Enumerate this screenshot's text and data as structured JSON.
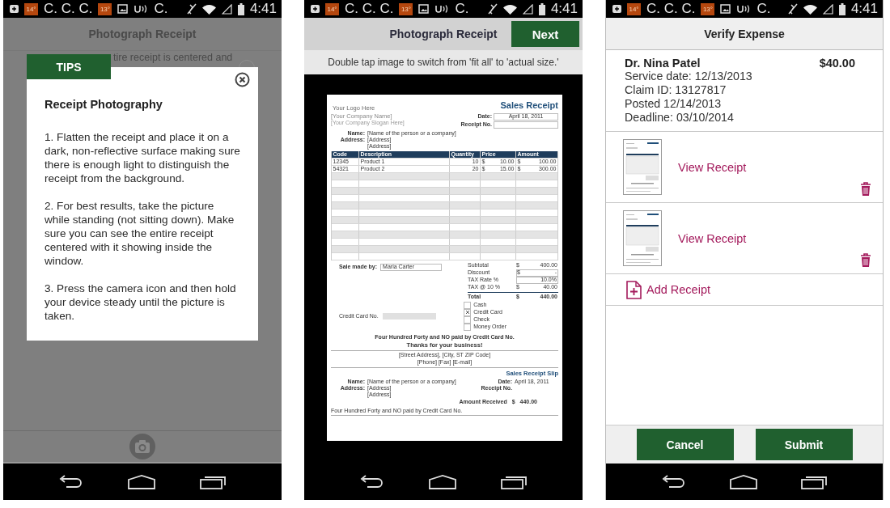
{
  "screens": [
    {
      "kind": "tips",
      "status_bar": {
        "temp_1": "14°",
        "text_1": "C. C. C.",
        "temp_2": "13°",
        "text_2": "C.",
        "time": "4:41"
      },
      "title": "Photograph Receipt",
      "background_text": "tire receipt is centered and",
      "dialog": {
        "tab": "TIPS",
        "heading": "Receipt Photography",
        "paragraphs": [
          "1. Flatten the receipt and place it on a dark, non-reflective surface making sure there is enough light to distinguish the receipt from the background.",
          "2. For best results, take the picture while standing (not sitting down).  Make sure you can see the entire receipt centered with it showing inside the window.",
          "3.  Press the camera icon and then hold your device steady until the picture is taken."
        ]
      }
    },
    {
      "kind": "photograph",
      "status_bar": {
        "temp_1": "14°",
        "text_1": "C. C. C.",
        "temp_2": "13°",
        "text_2": "C.",
        "time": "4:41"
      },
      "title": "Photograph Receipt",
      "next_button": "Next",
      "hint": "Double tap image to switch from 'fit all' to 'actual size.'",
      "receipt": {
        "logo": "Your Logo Here",
        "title": "Sales Receipt",
        "company": "[Your Company Name]",
        "slogan": "[Your Company Slogan Here]",
        "date_label": "Date:",
        "date": "April 18, 2011",
        "receipt_no_label": "Receipt No.",
        "name_label": "Name:",
        "name": "[Name of the person or a company]",
        "address_label": "Address:",
        "address_lines": [
          "[Address]",
          "[Address]"
        ],
        "columns": [
          "Code",
          "Description",
          "Quantity",
          "Price",
          "Amount"
        ],
        "rows": [
          {
            "code": "12345",
            "description": "Product 1",
            "quantity": "10",
            "price_symbol": "$",
            "price": "10.00",
            "amount_symbol": "$",
            "amount": "100.00"
          },
          {
            "code": "54321",
            "description": "Product 2",
            "quantity": "20",
            "price_symbol": "$",
            "price": "15.00",
            "amount_symbol": "$",
            "amount": "300.00"
          }
        ],
        "sale_by_label": "Sale made by:",
        "sale_by": "Maria Carter",
        "totals": [
          {
            "kind": "line",
            "label": "Subtotal",
            "symbol": "$",
            "value": "400.00"
          },
          {
            "kind": "boxed",
            "label": "Discount",
            "symbol": "$",
            "value": "-"
          },
          {
            "kind": "boxed",
            "label": "TAX Rate %",
            "value": "10.0%"
          },
          {
            "kind": "line",
            "label": "TAX @ 10 %",
            "symbol": "$",
            "value": "40.00"
          },
          {
            "kind": "total",
            "label": "Total",
            "symbol": "$",
            "value": "440.00"
          }
        ],
        "card_no_label": "Credit Card No.",
        "payment_methods": [
          {
            "label": "Cash",
            "checked": false
          },
          {
            "label": "Credit Card",
            "checked": true
          },
          {
            "label": "Check",
            "checked": false
          },
          {
            "label": "Money Order",
            "checked": false
          }
        ],
        "amount_words": "Four Hundred Forty and NO paid by Credit Card No.",
        "thanks": "Thanks for your business!",
        "address_footer": "[Street Address], [City, ST  ZIP Code]",
        "contact_footer": "[Phone]  [Fax]  [E-mail]",
        "slip": {
          "title": "Sales Receipt Slip",
          "name_label": "Name:",
          "name": "[Name of the person or a company]",
          "date_label": "Date:",
          "date": "April 18, 2011",
          "address_label": "Address:",
          "address_lines": [
            "[Address]",
            "[Address]"
          ],
          "receipt_no_label": "Receipt No.",
          "amount_label": "Amount Received",
          "amount_symbol": "$",
          "amount": "440.00",
          "amount_words": "Four Hundred Forty and NO paid by Credit Card No."
        }
      }
    },
    {
      "kind": "verify",
      "status_bar": {
        "temp_1": "14°",
        "text_1": "C. C. C.",
        "temp_2": "13°",
        "text_2": "C.",
        "time": "4:41"
      },
      "title": "Verify Expense",
      "expense": {
        "name": "Dr. Nina Patel",
        "amount": "$40.00",
        "lines": [
          "Service date:  12/13/2013",
          "Claim ID:  13127817",
          "Posted 12/14/2013",
          "Deadline:  03/10/2014"
        ]
      },
      "receipts": [
        {
          "label": "View Receipt"
        },
        {
          "label": "View Receipt"
        }
      ],
      "add_receipt": "Add Receipt",
      "buttons": [
        "Cancel",
        "Submit"
      ]
    }
  ]
}
